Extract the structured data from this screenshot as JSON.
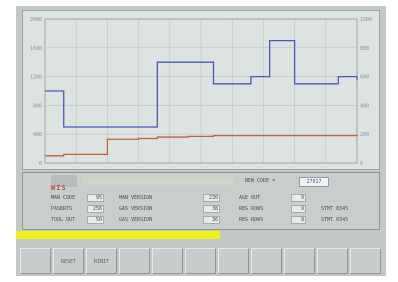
{
  "chart_data": {
    "type": "line",
    "title": "",
    "xlabel": "",
    "ylabel": "",
    "grid": true,
    "ylim": [
      0,
      2000
    ],
    "y_tick_labels_left": [
      "0",
      "400",
      "800",
      "1200",
      "1600",
      "2000"
    ],
    "y_tick_labels_right": [
      "0",
      "200",
      "400",
      "600",
      "800",
      "1000"
    ],
    "x": [
      0,
      3,
      6,
      20,
      30,
      36,
      40,
      46,
      54,
      60,
      66,
      72,
      74,
      80,
      84,
      92,
      94,
      100
    ],
    "series": [
      {
        "color": "#4a58b8",
        "values": [
          1000,
          1000,
          500,
          500,
          500,
          1400,
          1400,
          1400,
          1100,
          1100,
          1200,
          1700,
          1700,
          1100,
          1100,
          1100,
          1200,
          1150
        ]
      },
      {
        "color": "#c06236",
        "values": [
          100,
          100,
          120,
          330,
          340,
          360,
          360,
          370,
          380,
          380,
          380,
          380,
          380,
          380,
          380,
          380,
          380,
          390
        ]
      }
    ]
  },
  "panel": {
    "logo": "WIS",
    "new_code_label": "NEW CODE =",
    "new_code_value": "27017",
    "rows": [
      {
        "a_label": "MAN CODE",
        "a_value": "95",
        "b_label": "MAN VERSION",
        "b_value": "230",
        "c_label": "AGE OUT",
        "c_value": "9",
        "d_label": ""
      },
      {
        "a_label": "PASBRTS",
        "a_value": "256",
        "b_label": "GAS VERSION",
        "b_value": "38",
        "c_label": "REG ROWS",
        "c_value": "9",
        "d_label": "STMT 0345"
      },
      {
        "a_label": "TOOL OUT",
        "a_value": "50",
        "b_label": "GAS VERSION",
        "b_value": "36",
        "c_label": "REG ROWS",
        "c_value": "9",
        "d_label": "STMT 0345"
      }
    ]
  },
  "progress": {
    "value": 0.55,
    "color": "#f0f01c"
  },
  "function_keys": [
    "",
    "RESET",
    "RINIT",
    "",
    "",
    "",
    "",
    "",
    "",
    "",
    ""
  ]
}
